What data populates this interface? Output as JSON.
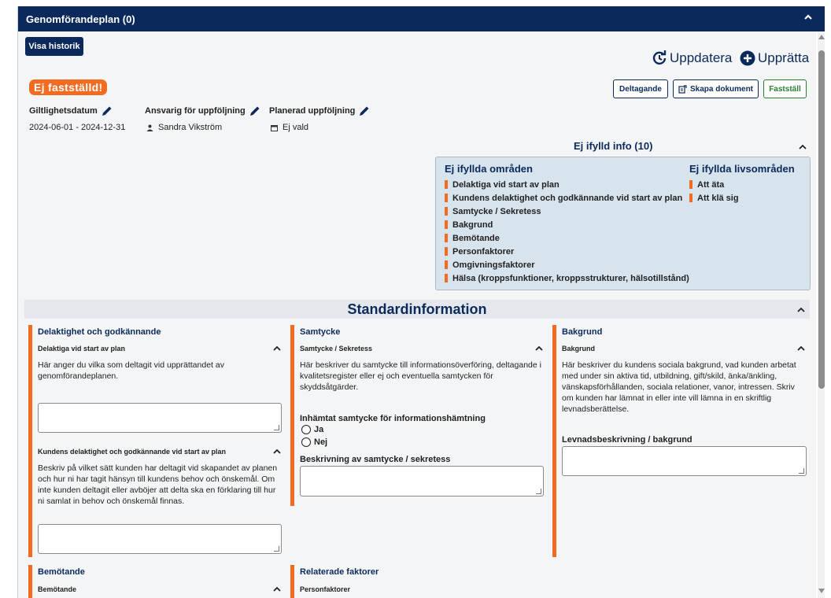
{
  "header": {
    "title": "Genomförandeplan (0)"
  },
  "toolbar": {
    "history_label": "Visa historik",
    "refresh_label": "Uppdatera",
    "create_label": "Upprätta"
  },
  "status": {
    "badge": "Ej fastställd!",
    "badge_color": "#f26b21"
  },
  "actions": {
    "participation_label": "Deltagande",
    "create_doc_label": "Skapa dokument",
    "confirm_label": "Fastställ"
  },
  "fields": {
    "validity_label": "Giltlighetsdatum",
    "validity_value": "2024-06-01 - 2024-12-31",
    "responsible_label": "Ansvarig för uppföljning",
    "responsible_value": "Sandra Vikström",
    "followup_label": "Planerad uppföljning",
    "followup_value": "Ej vald"
  },
  "info": {
    "heading": "Ej ifylld info (10)",
    "areas_heading": "Ej ifyllda områden",
    "areas": [
      "Delaktiga vid start av plan",
      "Kundens delaktighet och godkännande vid start av plan",
      "Samtycke / Sekretess",
      "Bakgrund",
      "Bemötande",
      "Personfaktorer",
      "Omgivningsfaktorer",
      "Hälsa (kroppsfunktioner, kroppsstrukturer, hälsotillstånd)"
    ],
    "life_heading": "Ej ifyllda livsområden",
    "life_areas": [
      "Att äta",
      "Att klä sig"
    ]
  },
  "standard": {
    "heading": "Standardinformation"
  },
  "sections": {
    "delaktighet": {
      "title": "Delaktighet och godkännande",
      "sub1": "Delaktiga vid start av plan",
      "desc1": "Här anger du vilka som deltagit vid upprättandet av genomförandeplanen.",
      "sub2": "Kundens delaktighet och godkännande vid start av plan",
      "desc2": "Beskriv på vilket sätt kunden har deltagit vid skapandet av planen och hur ni har tagit hänsyn till kundens behov och önskemål. Om inte kunden deltagit eller avböjer att delta ska en förklaring till hur ni samlat in behov och önskemål finnas."
    },
    "samtycke": {
      "title": "Samtycke",
      "sub1": "Samtycke / Sekretess",
      "desc1": "Här beskriver du samtycke till informationsöverföring, deltagande i kvalitetsregister eller ej och eventuella samtycken för skyddsåtgärder.",
      "question": "Inhämtat samtycke för informationshämtning",
      "opt_yes": "Ja",
      "opt_no": "Nej",
      "desc_label": "Beskrivning av samtycke / sekretess"
    },
    "bakgrund": {
      "title": "Bakgrund",
      "sub1": "Bakgrund",
      "desc1": "Här beskriver du kundens sociala bakgrund, vad kunden arbetat med under sin aktiva tid, utbildning, gift/skild, änka/änkling, vänskapsförhållanden, sociala relationer, vanor, intressen. Skriv om kunden har lämnat in eller inte vill lämna in en skriftlig levnadsberättelse.",
      "field_label": "Levnadsbeskrivning / bakgrund"
    },
    "bemotande": {
      "title": "Bemötande",
      "sub1": "Bemötande"
    },
    "relaterade": {
      "title": "Relaterade faktorer",
      "sub1": "Personfaktorer"
    }
  }
}
